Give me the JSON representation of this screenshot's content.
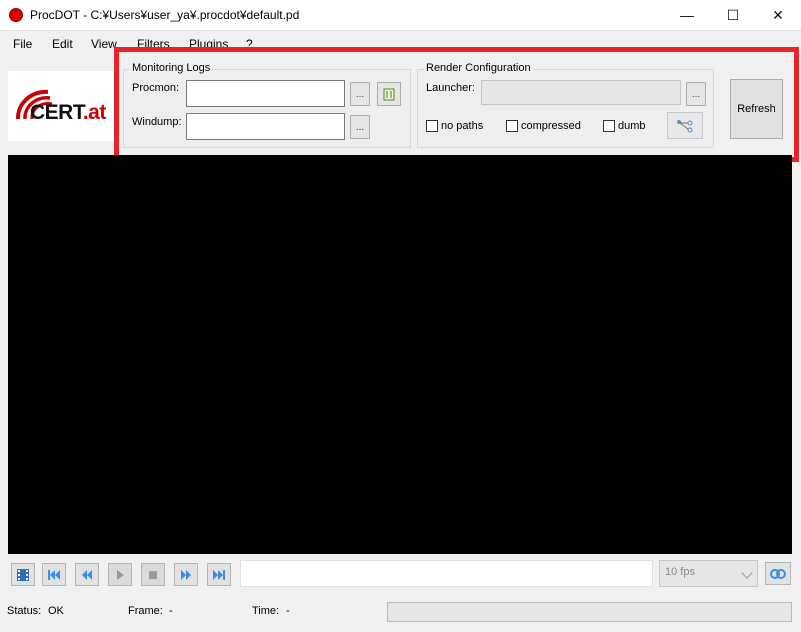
{
  "window": {
    "title": "ProcDOT - C:¥Users¥user_ya¥.procdot¥default.pd",
    "controls": {
      "minimize": "—",
      "maximize": "☐",
      "close": "✕"
    }
  },
  "menu": [
    "File",
    "Edit",
    "View",
    "Filters",
    "Plugins",
    "?"
  ],
  "logo": {
    "text": "CERT",
    "domain": ".at",
    "brand_color": "#cc0000"
  },
  "monitoring_logs": {
    "title": "Monitoring Logs",
    "procmon_label": "Procmon:",
    "procmon_value": "",
    "windump_label": "Windump:",
    "windump_value": "",
    "browse_label": "...",
    "clear_icon": "bucket-icon"
  },
  "render_configuration": {
    "title": "Render Configuration",
    "launcher_label": "Launcher:",
    "launcher_value": "",
    "browse_label": "...",
    "options": [
      {
        "label": "no paths",
        "checked": false
      },
      {
        "label": "compressed",
        "checked": false
      },
      {
        "label": "dumb",
        "checked": false
      }
    ],
    "graph_icon": "graph-layout-icon"
  },
  "refresh_label": "Refresh",
  "playback": {
    "buttons": [
      "film-icon",
      "skip-first-icon",
      "rewind-icon",
      "play-icon",
      "stop-icon",
      "fast-forward-icon",
      "skip-last-icon"
    ],
    "fps": "10 fps",
    "loop_icon": "loop-icon"
  },
  "status": {
    "status_label": "Status:",
    "status_value": "OK",
    "frame_label": "Frame:",
    "frame_value": "-",
    "time_label": "Time:",
    "time_value": "-"
  },
  "colors": {
    "highlight": "#e8232a",
    "canvas": "#000000"
  }
}
